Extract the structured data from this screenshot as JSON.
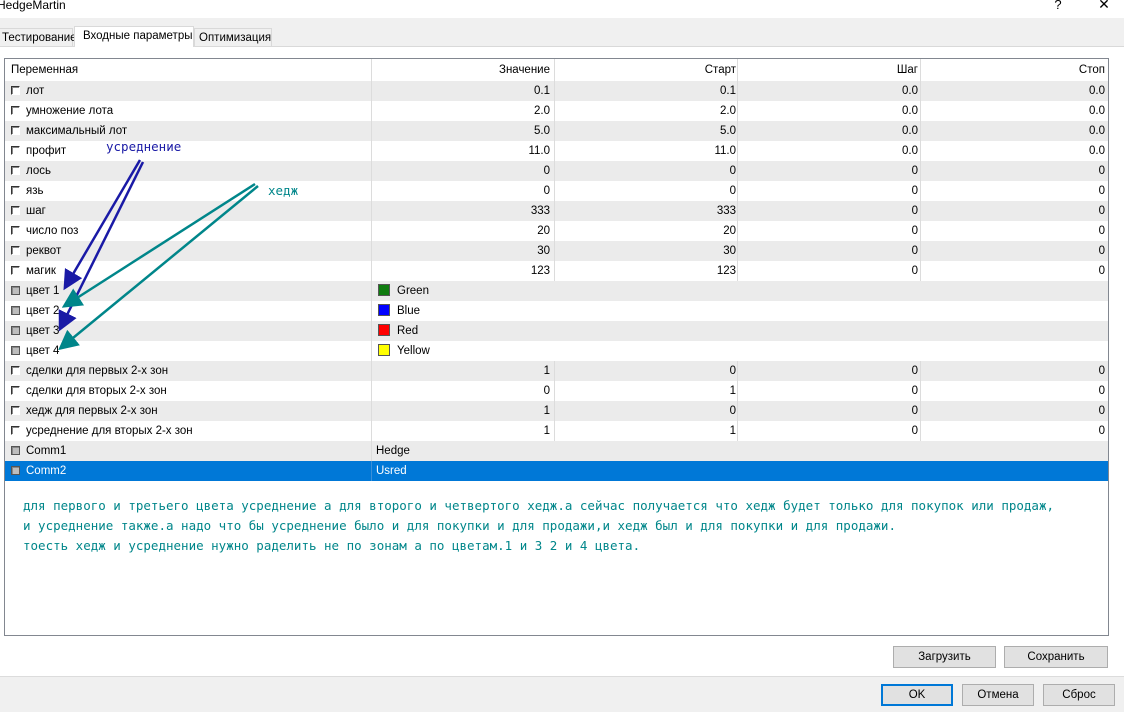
{
  "window": {
    "title": "HedgeMartin",
    "help": "?",
    "close": "✕"
  },
  "tabs": [
    {
      "label": "Тестирование"
    },
    {
      "label": "Входные параметры"
    },
    {
      "label": "Оптимизация"
    }
  ],
  "table": {
    "headers": [
      "Переменная",
      "Значение",
      "Старт",
      "Шаг",
      "Стоп"
    ],
    "rows": [
      {
        "name": "лот",
        "value": "0.1",
        "start": "0.1",
        "step": "0.0",
        "stop": "0.0"
      },
      {
        "name": "умножение лота",
        "value": "2.0",
        "start": "2.0",
        "step": "0.0",
        "stop": "0.0"
      },
      {
        "name": "максимальный лот",
        "value": "5.0",
        "start": "5.0",
        "step": "0.0",
        "stop": "0.0"
      },
      {
        "name": "профит",
        "value": "11.0",
        "start": "11.0",
        "step": "0.0",
        "stop": "0.0"
      },
      {
        "name": "лось",
        "value": "0",
        "start": "0",
        "step": "0",
        "stop": "0"
      },
      {
        "name": "язь",
        "value": "0",
        "start": "0",
        "step": "0",
        "stop": "0"
      },
      {
        "name": "шаг",
        "value": "333",
        "start": "333",
        "step": "0",
        "stop": "0"
      },
      {
        "name": "число поз",
        "value": "20",
        "start": "20",
        "step": "0",
        "stop": "0"
      },
      {
        "name": "реквот",
        "value": "30",
        "start": "30",
        "step": "0",
        "stop": "0"
      },
      {
        "name": "магик",
        "value": "123",
        "start": "123",
        "step": "0",
        "stop": "0"
      },
      {
        "name": "цвет 1",
        "color_name": "Green",
        "color": "#107c10"
      },
      {
        "name": "цвет 2",
        "color_name": "Blue",
        "color": "#0000ff"
      },
      {
        "name": "цвет 3",
        "color_name": "Red",
        "color": "#ff0000"
      },
      {
        "name": "цвет 4",
        "color_name": "Yellow",
        "color": "#ffff00"
      },
      {
        "name": "сделки для первых 2-х зон",
        "value": "1",
        "start": "0",
        "step": "0",
        "stop": "0"
      },
      {
        "name": "сделки для вторых 2-х зон",
        "value": "0",
        "start": "1",
        "step": "0",
        "stop": "0"
      },
      {
        "name": "хедж для первых 2-х зон",
        "value": "1",
        "start": "0",
        "step": "0",
        "stop": "0"
      },
      {
        "name": "усреднение для вторых 2-х зон",
        "value": "1",
        "start": "1",
        "step": "0",
        "stop": "0"
      },
      {
        "name": "Comm1",
        "text": "Hedge"
      },
      {
        "name": "Comm2",
        "text": "Usred"
      }
    ]
  },
  "annotations": {
    "averaging_label": "усреднение",
    "hedge_label": "хедж",
    "averaging_color": "#1a1aa6",
    "hedge_color": "#00868a",
    "note_lines": [
      "для первого и третьего цвета усреднение а для второго и четвертого хедж.а сейчас получается что хедж будет только для покупок или продаж,",
      "и усреднение также.а надо что бы усреднение было и для покупки и для продажи,и хедж был и для покупки и для продажи.",
      "тоесть хедж и усреднение нужно раделить не по зонам а по цветам.1 и 3    2 и 4 цвета."
    ]
  },
  "buttons": {
    "load": "Загрузить",
    "save": "Сохранить",
    "ok": "OK",
    "cancel": "Отмена",
    "reset": "Сброс"
  }
}
